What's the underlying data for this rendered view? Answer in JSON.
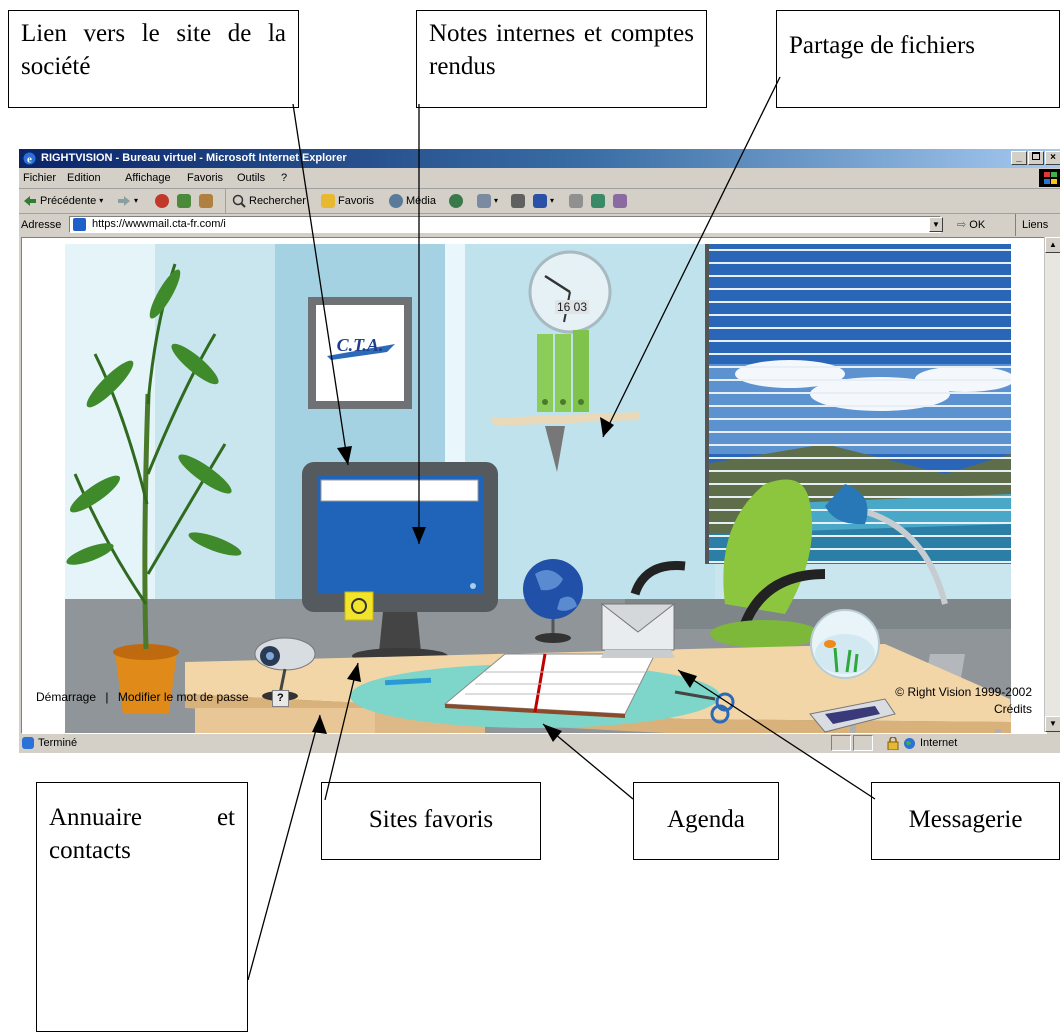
{
  "callouts": {
    "company_site": "Lien vers le site de la société",
    "notes": "Notes internes et comptes rendus",
    "file_sharing": "Partage de fichiers",
    "directory": "Annuaire et contacts",
    "favorite_sites": "Sites favoris",
    "agenda": "Agenda",
    "messaging": "Messagerie"
  },
  "window": {
    "title": "RIGHTVISION - Bureau virtuel - Microsoft Internet Explorer",
    "controls": [
      "_",
      "×"
    ],
    "menu": [
      "Fichier",
      "Edition",
      "Affichage",
      "Favoris",
      "Outils",
      "?"
    ],
    "toolbar": {
      "back": "Précédente",
      "search": "Rechercher",
      "favorites": "Favoris",
      "media": "Média"
    },
    "address": {
      "label": "Adresse",
      "url": "https://wwwmail.cta-fr.com/i",
      "go": "OK",
      "links": "Liens"
    },
    "status": {
      "text": "Terminé",
      "zone": "Internet"
    }
  },
  "office": {
    "logo_text": "C.T.A.",
    "clock_time": "16 03",
    "footer": {
      "home": "Démarrage",
      "separator": "|",
      "change_password": "Modifier le mot de passe",
      "help": "?"
    },
    "copyright": "© Right Vision 1999-2002",
    "credits": "Crédits"
  },
  "colors": {
    "titlebar_start": "#0a246a",
    "titlebar_end": "#a6caf0",
    "chrome": "#d4d0c8",
    "wall": "#b5d9e6",
    "desk": "#f3d6a8",
    "chair": "#8cc63f"
  },
  "icons": [
    "ie-logo-icon",
    "back-arrow-icon",
    "forward-arrow-icon",
    "stop-icon",
    "refresh-icon",
    "home-icon",
    "search-icon",
    "favorites-icon",
    "media-icon",
    "history-icon",
    "mail-icon",
    "print-icon",
    "word-icon",
    "edit-icon",
    "messenger-icon",
    "lock-icon",
    "globe-icon"
  ]
}
